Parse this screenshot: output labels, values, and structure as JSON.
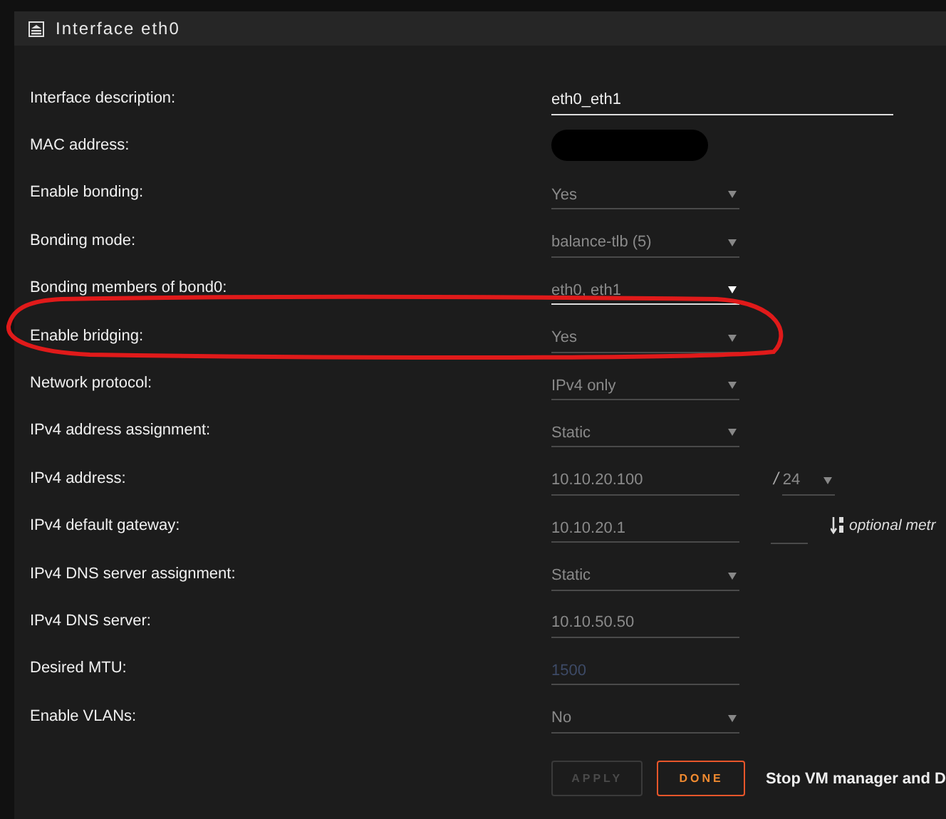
{
  "panel": {
    "title": "Interface eth0"
  },
  "rows": [
    {
      "label": "Interface description:",
      "kind": "input",
      "value": "eth0_eth1",
      "wide": true,
      "focused": false,
      "highlighted": false
    },
    {
      "label": "MAC address:",
      "kind": "redacted",
      "highlighted": false
    },
    {
      "label": "Enable bonding:",
      "kind": "select",
      "value": "Yes",
      "focused": false,
      "highlighted": false
    },
    {
      "label": "Bonding mode:",
      "kind": "select",
      "value": "balance-tlb (5)",
      "focused": false,
      "highlighted": false
    },
    {
      "label": "Bonding members of bond0:",
      "kind": "select",
      "value": "eth0, eth1",
      "focused": true,
      "highlighted": false
    },
    {
      "label": "Enable bridging:",
      "kind": "select",
      "value": "Yes",
      "focused": false,
      "highlighted": true
    },
    {
      "label": "Network protocol:",
      "kind": "select",
      "value": "IPv4 only",
      "focused": false,
      "highlighted": false
    },
    {
      "label": "IPv4 address assignment:",
      "kind": "select",
      "value": "Static",
      "focused": false,
      "highlighted": false
    },
    {
      "label": "IPv4 address:",
      "kind": "input",
      "value": "10.10.20.100",
      "focused": false,
      "highlighted": false,
      "extra": {
        "kind": "netmask",
        "separator": "/",
        "value": "24"
      }
    },
    {
      "label": "IPv4 default gateway:",
      "kind": "input",
      "value": "10.10.20.1",
      "focused": false,
      "highlighted": false,
      "extra": {
        "kind": "metric",
        "hint": "optional metr"
      }
    },
    {
      "label": "IPv4 DNS server assignment:",
      "kind": "select",
      "value": "Static",
      "focused": false,
      "highlighted": false
    },
    {
      "label": "IPv4 DNS server:",
      "kind": "input",
      "value": "10.10.50.50",
      "focused": false,
      "highlighted": false
    },
    {
      "label": "Desired MTU:",
      "kind": "input",
      "placeholder": "1500",
      "focused": false,
      "highlighted": false
    },
    {
      "label": "Enable VLANs:",
      "kind": "select",
      "value": "No",
      "focused": false,
      "highlighted": false
    }
  ],
  "buttons": [
    {
      "label": "APPLY",
      "kind": "apply",
      "disabled": true
    },
    {
      "label": "DONE",
      "kind": "done",
      "disabled": false
    }
  ],
  "note": "Stop VM manager and D"
}
